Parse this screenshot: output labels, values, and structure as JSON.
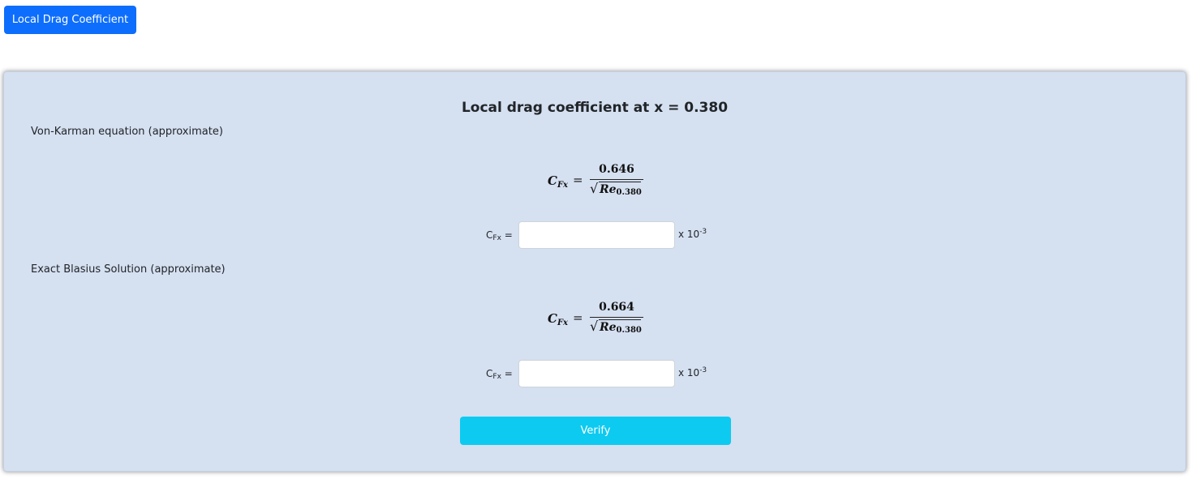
{
  "top_button": {
    "label": "Local Drag Coefficient"
  },
  "panel": {
    "title": "Local drag coefficient at x = 0.380",
    "sections": [
      {
        "label": "Von-Karman equation (approximate)",
        "formula": {
          "lhs_symbol": "C",
          "lhs_subscript": "Fx",
          "equals": "=",
          "numerator": "0.646",
          "radical": "√",
          "den_symbol": "Re",
          "den_subscript": "0.380"
        },
        "input": {
          "label_symbol": "C",
          "label_subscript": "Fx",
          "label_suffix": " =",
          "value": "",
          "placeholder": "",
          "unit_prefix": "x 10",
          "unit_exponent": "-3"
        }
      },
      {
        "label": "Exact Blasius Solution (approximate)",
        "formula": {
          "lhs_symbol": "C",
          "lhs_subscript": "Fx",
          "equals": "=",
          "numerator": "0.664",
          "radical": "√",
          "den_symbol": "Re",
          "den_subscript": "0.380"
        },
        "input": {
          "label_symbol": "C",
          "label_subscript": "Fx",
          "label_suffix": " =",
          "value": "",
          "placeholder": "",
          "unit_prefix": "x 10",
          "unit_exponent": "-3"
        }
      }
    ],
    "verify_label": "Verify"
  },
  "colors": {
    "primary_button": "#0d6efd",
    "panel_background": "#d5e0f1",
    "verify_button": "#0dcaf0"
  }
}
